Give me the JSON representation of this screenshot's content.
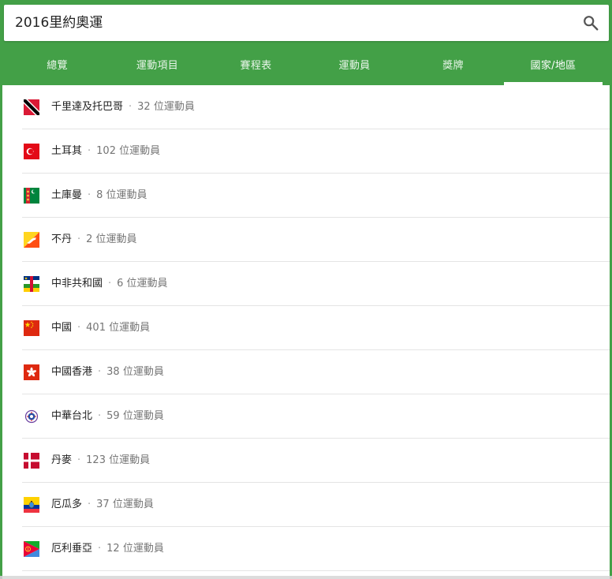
{
  "search": {
    "query": "2016里約奧運",
    "icon": "search-icon"
  },
  "tabs": [
    {
      "label": "總覽",
      "active": false
    },
    {
      "label": "運動項目",
      "active": false
    },
    {
      "label": "賽程表",
      "active": false
    },
    {
      "label": "運動員",
      "active": false
    },
    {
      "label": "獎牌",
      "active": false
    },
    {
      "label": "國家/地區",
      "active": true
    }
  ],
  "colors": {
    "header_green": "#43a047",
    "text": "#222222",
    "secondary": "#757575"
  },
  "separator": "·",
  "countries": [
    {
      "name": "千里達及托巴哥",
      "count": "32 位運動員",
      "flag": "trinidad-and-tobago-flag-icon"
    },
    {
      "name": "土耳其",
      "count": "102 位運動員",
      "flag": "turkey-flag-icon"
    },
    {
      "name": "土庫曼",
      "count": "8 位運動員",
      "flag": "turkmenistan-flag-icon"
    },
    {
      "name": "不丹",
      "count": "2 位運動員",
      "flag": "bhutan-flag-icon"
    },
    {
      "name": "中非共和國",
      "count": "6 位運動員",
      "flag": "central-african-republic-flag-icon"
    },
    {
      "name": "中國",
      "count": "401 位運動員",
      "flag": "china-flag-icon"
    },
    {
      "name": "中國香港",
      "count": "38 位運動員",
      "flag": "hong-kong-flag-icon"
    },
    {
      "name": "中華台北",
      "count": "59 位運動員",
      "flag": "chinese-taipei-flag-icon"
    },
    {
      "name": "丹麥",
      "count": "123 位運動員",
      "flag": "denmark-flag-icon"
    },
    {
      "name": "厄瓜多",
      "count": "37 位運動員",
      "flag": "ecuador-flag-icon"
    },
    {
      "name": "厄利垂亞",
      "count": "12 位運動員",
      "flag": "eritrea-flag-icon"
    }
  ]
}
